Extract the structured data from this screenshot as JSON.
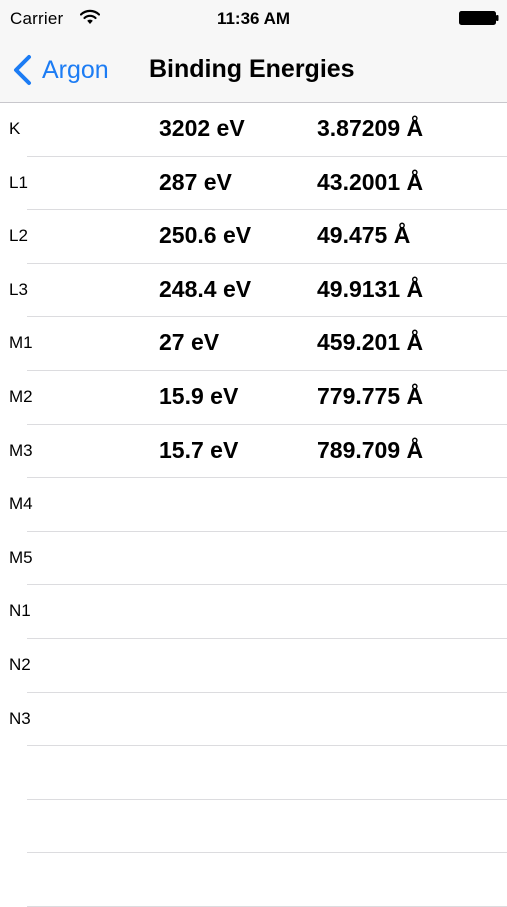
{
  "status_bar": {
    "carrier": "Carrier",
    "time": "11:36 AM"
  },
  "nav": {
    "back_label": "Argon",
    "title": "Binding Energies",
    "accent_color": "#1c7cf4"
  },
  "rows": [
    {
      "shell": "K",
      "energy": "3202 eV",
      "wavelength": "3.87209 Å"
    },
    {
      "shell": "L1",
      "energy": "287 eV",
      "wavelength": "43.2001 Å"
    },
    {
      "shell": "L2",
      "energy": "250.6 eV",
      "wavelength": "49.475 Å"
    },
    {
      "shell": "L3",
      "energy": "248.4 eV",
      "wavelength": "49.9131 Å"
    },
    {
      "shell": "M1",
      "energy": "27 eV",
      "wavelength": "459.201 Å"
    },
    {
      "shell": "M2",
      "energy": "15.9 eV",
      "wavelength": "779.775 Å"
    },
    {
      "shell": "M3",
      "energy": "15.7 eV",
      "wavelength": "789.709 Å"
    },
    {
      "shell": "M4",
      "energy": "",
      "wavelength": ""
    },
    {
      "shell": "M5",
      "energy": "",
      "wavelength": ""
    },
    {
      "shell": "N1",
      "energy": "",
      "wavelength": ""
    },
    {
      "shell": "N2",
      "energy": "",
      "wavelength": ""
    },
    {
      "shell": "N3",
      "energy": "",
      "wavelength": ""
    },
    {
      "shell": "",
      "energy": "",
      "wavelength": ""
    },
    {
      "shell": "",
      "energy": "",
      "wavelength": ""
    },
    {
      "shell": "",
      "energy": "",
      "wavelength": ""
    }
  ]
}
